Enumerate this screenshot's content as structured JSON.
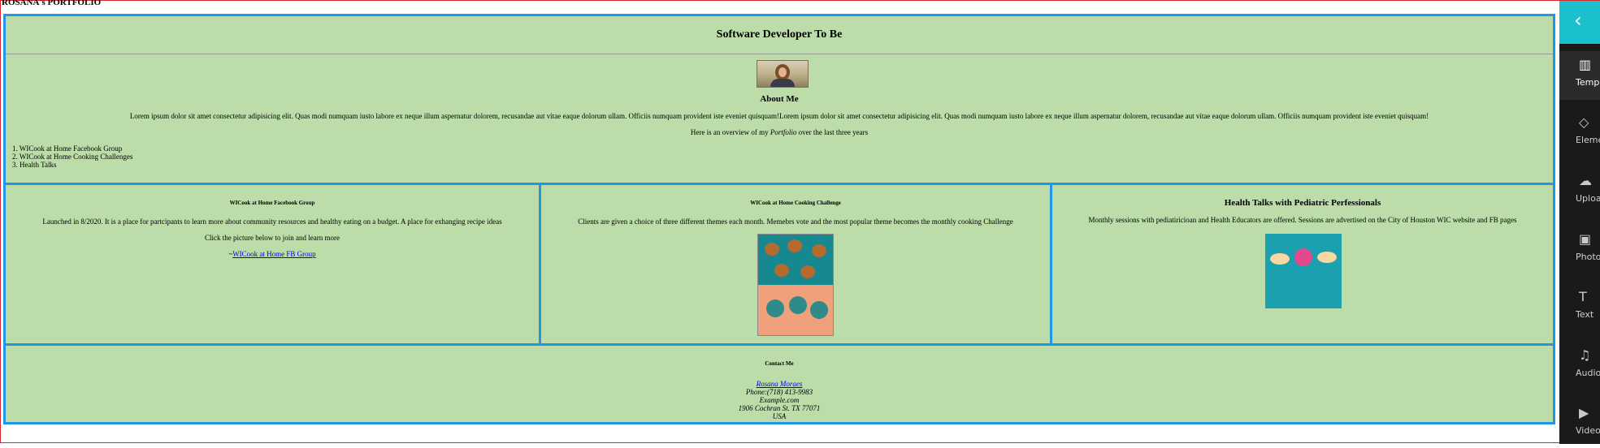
{
  "site_title": "ROSANA's PORTFOLIO",
  "hero": {
    "title": "Software Developer To Be",
    "about_title": "About Me",
    "about_text": "Lorem ipsum dolor sit amet consectetur adipisicing elit. Quas modi numquam iusto labore ex neque illum aspernatur dolorem, recusandae aut vitae eaque dolorum ullam. Officiis numquam provident iste eveniet quisquam!Lorem ipsum dolor sit amet consectetur adipisicing elit. Quas modi numquam iusto labore ex neque illum aspernatur dolorem, recusandae aut vitae eaque dolorum ullam. Officiis numquam provident iste eveniet quisquam!",
    "overview_prefix": "Here is an overview of my ",
    "overview_em": "Portfolio",
    "overview_suffix": " over the last three years",
    "list": [
      "1. WICook at Home Facebook Group",
      "2. WICook at Home Cooking Challenges",
      "3. Health Talks"
    ]
  },
  "projects": [
    {
      "title": "WICook at Home Facebook Group",
      "desc": "Launched in 8/2020. It is a place for partcipants to learn more about community resources and healthy eating on a budget. A place for exhanging recipe ideas",
      "desc2": "Click the picture below to join and learn more",
      "link_prefix": "~",
      "link": "WICook at Home FB Group"
    },
    {
      "title": "WICook at Home Cooking Challenge",
      "desc": "Clients are given a choice of three different themes each month. Memebrs vote and the most popular theme becomes the monthly cooking Challenge"
    },
    {
      "title": "Health Talks with Pediatric Perfessionals",
      "desc": "Monthly sessions with pediatiricioan and Health Educators are offered. Sessions are advertised on the City of Houston WIC website and FB pages"
    }
  ],
  "contact": {
    "title": "Contact Me",
    "name": "Rosana Moraes",
    "phone": "Phone:(718) 413-9983",
    "email": "Example.com",
    "address": "1906 Cochran St. TX 77071",
    "country": "USA"
  },
  "side_panel": {
    "back_icon": "chevron-left-icon",
    "tools": [
      {
        "label": "Templat",
        "icon": "template-icon"
      },
      {
        "label": "Elemen",
        "icon": "elements-icon"
      },
      {
        "label": "Upload",
        "icon": "upload-icon"
      },
      {
        "label": "Photo",
        "icon": "photo-icon"
      },
      {
        "label": "Text",
        "icon": "text-icon"
      },
      {
        "label": "Audio",
        "icon": "audio-icon"
      },
      {
        "label": "Video",
        "icon": "video-icon"
      }
    ]
  },
  "colors": {
    "border": "#2196e8",
    "background": "#bcdcaa",
    "panel_accent": "#1bc0cf",
    "panel_bg": "#1a1a1a"
  }
}
